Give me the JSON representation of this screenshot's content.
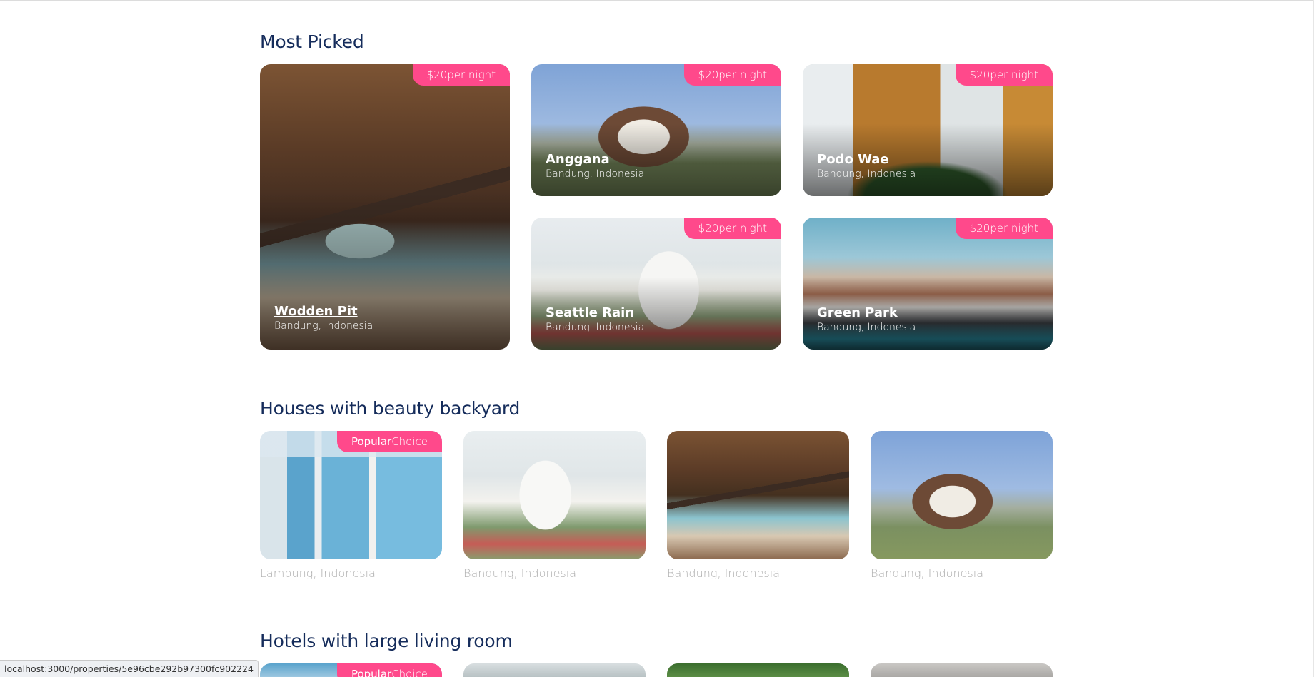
{
  "most_picked": {
    "title": "Most Picked",
    "items": [
      {
        "name": "Wodden Pit",
        "location": "Bandung, Indonesia",
        "price": "$20",
        "unit": "per night"
      },
      {
        "name": "Anggana",
        "location": "Bandung, Indonesia",
        "price": "$20",
        "unit": "per night"
      },
      {
        "name": "Podo Wae",
        "location": "Bandung, Indonesia",
        "price": "$20",
        "unit": "per night"
      },
      {
        "name": "Seattle Rain",
        "location": "Bandung, Indonesia",
        "price": "$20",
        "unit": "per night"
      },
      {
        "name": "Green Park",
        "location": "Bandung, Indonesia",
        "price": "$20",
        "unit": "per night"
      }
    ]
  },
  "categories": [
    {
      "title": "Houses with beauty backyard",
      "items": [
        {
          "location": "Lampung, Indonesia",
          "popular": true
        },
        {
          "location": "Bandung, Indonesia",
          "popular": false
        },
        {
          "location": "Bandung, Indonesia",
          "popular": false
        },
        {
          "location": "Bandung, Indonesia",
          "popular": false
        }
      ]
    },
    {
      "title": "Hotels with large living room",
      "items": [
        {
          "popular": true
        },
        {
          "popular": false
        },
        {
          "popular": false
        },
        {
          "popular": false
        }
      ]
    }
  ],
  "popular_tag": {
    "bold": "Popular",
    "light": "Choice"
  },
  "status_bar": {
    "url": "localhost:3000/properties/5e96cbe292b97300fc902224"
  },
  "colors": {
    "accent": "#ff498b",
    "heading": "#152c5b",
    "muted": "#b0b0b0"
  }
}
